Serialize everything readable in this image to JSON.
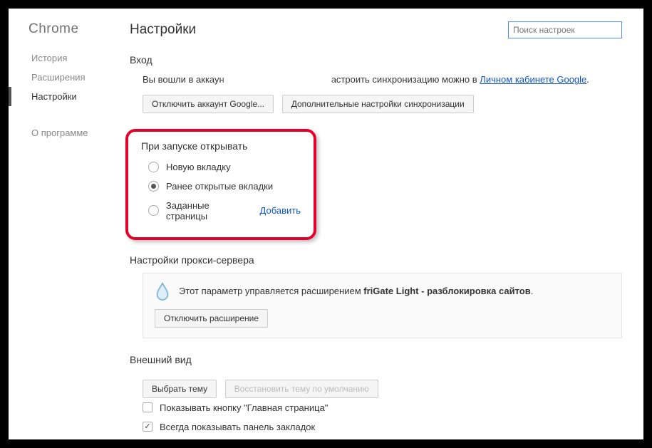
{
  "sidebar": {
    "title": "Chrome",
    "items": [
      {
        "label": "История",
        "active": false
      },
      {
        "label": "Расширения",
        "active": false
      },
      {
        "label": "Настройки",
        "active": true
      }
    ],
    "about": "О программе"
  },
  "header": {
    "page_title": "Настройки",
    "search_placeholder": "Поиск настроек"
  },
  "login": {
    "title": "Вход",
    "text_prefix": "Вы вошли в аккаун",
    "text_suffix": "астроить синхронизацию можно в ",
    "link": "Личном кабинете Google",
    "period": ".",
    "button_disconnect": "Отключить аккаунт Google...",
    "button_advanced": "Дополнительные настройки синхронизации"
  },
  "startup": {
    "title": "При запуске открывать",
    "options": [
      {
        "label": "Новую вкладку",
        "checked": false
      },
      {
        "label": "Ранее открытые вкладки",
        "checked": true
      },
      {
        "label": "Заданные страницы",
        "checked": false,
        "extra_link": "Добавить"
      }
    ]
  },
  "proxy": {
    "title": "Настройки прокси-сервера",
    "managed_text": "Этот параметр управляется расширением ",
    "extension_name": "friGate Light - разблокировка сайтов",
    "period": ".",
    "button_disable": "Отключить расширение"
  },
  "appearance": {
    "title": "Внешний вид",
    "button_theme": "Выбрать тему",
    "button_reset_theme": "Восстановить тему по умолчанию",
    "checkbox_home": {
      "label": "Показывать кнопку \"Главная страница\"",
      "checked": false
    },
    "checkbox_bookmarks": {
      "label": "Всегда показывать панель закладок",
      "checked": true
    }
  }
}
